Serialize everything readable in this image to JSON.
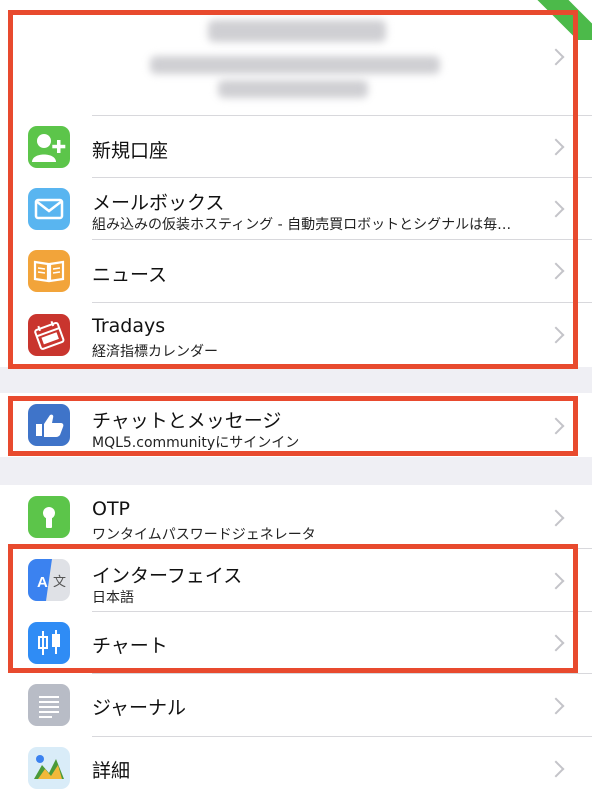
{
  "account": {
    "name": "",
    "details": ""
  },
  "badge": "",
  "items": {
    "new_account": {
      "title": "新規口座"
    },
    "mailbox": {
      "title": "メールボックス",
      "subtitle": "組み込みの仮装ホスティング - 自動売買ロボットとシグナルは毎…"
    },
    "news": {
      "title": "ニュース"
    },
    "tradays": {
      "title": "Tradays",
      "subtitle": "経済指標カレンダー"
    },
    "chat": {
      "title": "チャットとメッセージ",
      "subtitle": "MQL5.communityにサインイン"
    },
    "otp": {
      "title": "OTP",
      "subtitle": "ワンタイムパスワードジェネレータ"
    },
    "interface": {
      "title": "インターフェイス",
      "subtitle": "日本語"
    },
    "chart": {
      "title": "チャート"
    },
    "journal": {
      "title": "ジャーナル"
    },
    "details": {
      "title": "詳細"
    }
  },
  "icons": {
    "new_account": "add-user-icon",
    "mailbox": "envelope-icon",
    "news": "book-icon",
    "tradays": "calendar-icon",
    "chat": "thumbs-up-icon",
    "otp": "keyhole-icon",
    "interface": "language-icon",
    "chart": "candlestick-icon",
    "journal": "document-icon",
    "details": "metatrader-icon"
  },
  "colors": {
    "highlight": "#e84a2e",
    "badge": "#4cba4a",
    "new_account": "#5cc54a",
    "mailbox": "#59b5f0",
    "news": "#f2a43a",
    "tradays": "#c9352e",
    "chat": "#3f74c9",
    "otp": "#5cc54a",
    "interface": "#3b82f0",
    "chart": "#2f8cf5",
    "journal": "#b8bcc6"
  }
}
